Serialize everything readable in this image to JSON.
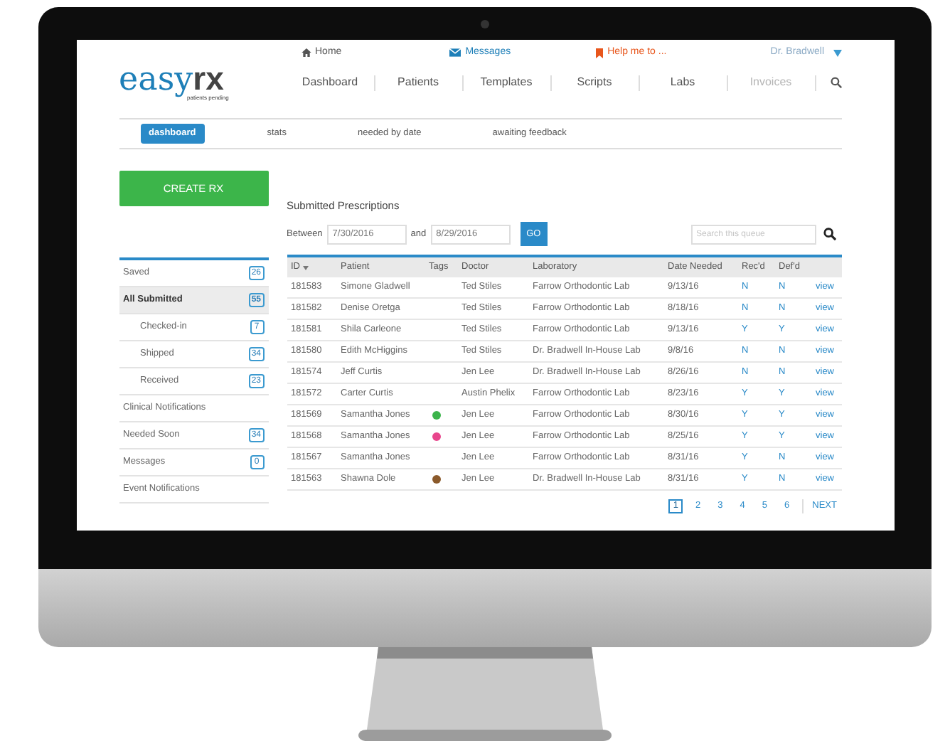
{
  "top_links": [
    {
      "kind": "home",
      "label": "Home"
    },
    {
      "kind": "messages",
      "label": "Messages"
    },
    {
      "kind": "help",
      "label": "Help me to ..."
    },
    {
      "kind": "user",
      "label": "Dr. Bradwell"
    }
  ],
  "logo": {
    "part_1": "easy",
    "part_2": "rx",
    "tagline": "patients pending"
  },
  "nav": [
    {
      "label": "Dashboard",
      "disabled": false
    },
    {
      "label": "Patients",
      "disabled": false
    },
    {
      "label": "Templates",
      "disabled": false
    },
    {
      "label": "Scripts",
      "disabled": false
    },
    {
      "label": "Labs",
      "disabled": false
    },
    {
      "label": "Invoices",
      "disabled": true
    }
  ],
  "subtabs": [
    {
      "label": "dashboard",
      "selected": true
    },
    {
      "label": "stats",
      "selected": false
    },
    {
      "label": "needed by date",
      "selected": false
    },
    {
      "label": "awaiting feedback",
      "selected": false
    }
  ],
  "create_button": "CREATE RX",
  "sidebar": [
    {
      "label": "Saved",
      "count": "26",
      "selected": false
    },
    {
      "label": "All Submitted",
      "count": "55",
      "selected": true,
      "children": [
        {
          "label": "Checked-in",
          "count": "7",
          "selected": false
        },
        {
          "label": "Shipped",
          "count": "34",
          "selected": false
        },
        {
          "label": "Received",
          "count": "23",
          "selected": false
        }
      ]
    },
    {
      "label": "Clinical Notifications",
      "selected": false
    },
    {
      "label": "Needed Soon",
      "count": "34",
      "selected": false
    },
    {
      "label": "Messages",
      "count": "0",
      "selected": false
    },
    {
      "label": "Event Notifications",
      "selected": false
    }
  ],
  "main": {
    "title": "Submitted Prescriptions",
    "filter": {
      "label": "Between",
      "from": "7/30/2016",
      "joiner": "and",
      "to": "8/29/2016",
      "go": "GO"
    },
    "search": {
      "placeholder": "Search this queue"
    }
  },
  "table": {
    "columns": [
      "ID",
      "Patient",
      "Tags",
      "Doctor",
      "Laboratory",
      "Date Needed",
      "Rec'd",
      "Def'd"
    ],
    "rows": [
      {
        "id": "181583",
        "patient": "Simone Gladwell",
        "doctor": "Ted Stiles",
        "lab": "Farrow Orthodontic Lab",
        "date": "9/13/16",
        "recd": "N",
        "defd": "N",
        "action": "view"
      },
      {
        "id": "181582",
        "patient": "Denise Oretga",
        "doctor": "Ted Stiles",
        "lab": "Farrow Orthodontic Lab",
        "date": "8/18/16",
        "recd": "N",
        "defd": "N",
        "action": "view"
      },
      {
        "id": "181581",
        "patient": "Shila Carleone",
        "doctor": "Ted Stiles",
        "lab": "Farrow Orthodontic Lab",
        "date": "9/13/16",
        "recd": "Y",
        "defd": "Y",
        "action": "view"
      },
      {
        "id": "181580",
        "patient": "Edith McHiggins",
        "doctor": "Ted Stiles",
        "lab": "Dr. Bradwell In-House Lab",
        "date": "9/8/16",
        "recd": "N",
        "defd": "N",
        "action": "view"
      },
      {
        "id": "181574",
        "patient": "Jeff Curtis",
        "doctor": "Jen Lee",
        "lab": "Dr. Bradwell In-House Lab",
        "date": "8/26/16",
        "recd": "N",
        "defd": "N",
        "action": "view"
      },
      {
        "id": "181572",
        "patient": "Carter Curtis",
        "doctor": "Austin Phelix",
        "lab": "Farrow Orthodontic Lab",
        "date": "8/23/16",
        "recd": "Y",
        "defd": "Y",
        "action": "view"
      },
      {
        "id": "181569",
        "patient": "Samantha Jones",
        "color": "#3cb44b",
        "doctor": "Jen Lee",
        "lab": "Farrow Orthodontic Lab",
        "date": "8/30/16",
        "recd": "Y",
        "defd": "Y",
        "action": "view"
      },
      {
        "id": "181568",
        "patient": "Samantha Jones",
        "color": "#e8468c",
        "doctor": "Jen Lee",
        "lab": "Farrow Orthodontic Lab",
        "date": "8/25/16",
        "recd": "Y",
        "defd": "Y",
        "action": "view"
      },
      {
        "id": "181567",
        "patient": "Samantha Jones",
        "doctor": "Jen Lee",
        "lab": "Farrow Orthodontic Lab",
        "date": "8/31/16",
        "recd": "Y",
        "defd": "N",
        "action": "view"
      },
      {
        "id": "181563",
        "patient": "Shawna Dole",
        "color": "#8b5a2b",
        "doctor": "Jen Lee",
        "lab": "Dr. Bradwell In-House Lab",
        "date": "8/31/16",
        "recd": "Y",
        "defd": "N",
        "action": "view"
      }
    ]
  },
  "pagination": {
    "pages": [
      {
        "label": "1",
        "selected": true
      },
      {
        "label": "2",
        "selected": false
      },
      {
        "label": "3",
        "selected": false
      },
      {
        "label": "4",
        "selected": false
      },
      {
        "label": "5",
        "selected": false
      },
      {
        "label": "6",
        "selected": false
      }
    ],
    "next": "NEXT"
  }
}
